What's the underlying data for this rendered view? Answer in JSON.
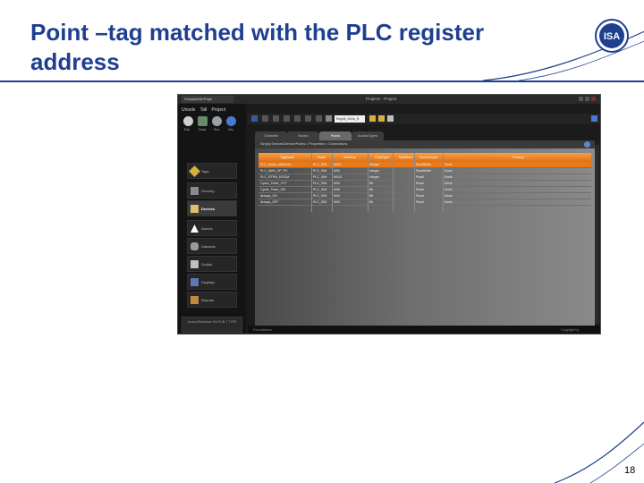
{
  "slide": {
    "title": "Point –tag matched with the PLC register address",
    "page_number": "18",
    "logo_text": "ISA"
  },
  "app": {
    "doc_tab": "DisplayMainPage",
    "window_title": "Projects - Project",
    "mode_tabs": [
      "Unsols",
      "Tall",
      "Project"
    ],
    "mode_buttons": [
      "Edit",
      "Draw",
      "Run",
      "Info"
    ],
    "nav_items": [
      "Tags",
      "Security",
      "Devices",
      "Alarms",
      "Datasets",
      "Scripts",
      "Displays",
      "Reports"
    ],
    "active_nav": "Devices",
    "left_status": "Access/Rulebase MV-PUB-7 TYPE",
    "toolbar_field": "RegAll_SeSa_N",
    "view_tabs": [
      "Channels",
      "Nodes",
      "Points",
      "AccessTypes"
    ],
    "active_view_tab": "Points",
    "content_header": "Simply Devices/Device/Points > Properties > Connections",
    "grid": {
      "columns": [
        "TagName",
        "Node",
        "Address",
        "DataType",
        "Modifiers",
        "AccessType",
        "Scaling"
      ],
      "rows": [
        [
          "PLC_Mode_MANUAL",
          "PLC_SIM",
          "M001",
          "Integer",
          "",
          "ReadWrite",
          "None"
        ],
        [
          "PLC_MAN_SP_PV",
          "PLC_SIM",
          "M00",
          "Integer",
          "",
          "ReadWrite",
          "None"
        ],
        [
          "PLC_RTRN_ROOM",
          "PLC_SIM",
          "M010",
          "Integer",
          "",
          "Read",
          "None"
        ],
        [
          "Cyclic_Timer_VYT",
          "PLC_SIM",
          "M00",
          "Bit",
          "",
          "Read",
          "None"
        ],
        [
          "Cyclic_Timer_ON",
          "PLC_SIM",
          "M00",
          "Bit",
          "",
          "Read",
          "None"
        ],
        [
          "Always_ON",
          "PLC_SIM",
          "M00",
          "Bit",
          "",
          "Read",
          "None"
        ],
        [
          "Always_OFF",
          "PLC_SIM",
          "M00",
          "Bit",
          "",
          "Read",
          "None"
        ]
      ]
    },
    "status_left": "Find address",
    "status_right": "Copyright by"
  },
  "colors": {
    "title_blue": "#1f3f8f",
    "grid_header_orange": "#e87a1a",
    "app_background": "#1b1b1b"
  },
  "icons": [
    "isa-logo",
    "gear-icon",
    "folder-icon",
    "eye-icon",
    "info-icon",
    "tag-icon",
    "lock-icon",
    "device-icon",
    "alarm-icon",
    "database-icon",
    "script-icon",
    "display-icon",
    "report-icon",
    "close-icon"
  ]
}
